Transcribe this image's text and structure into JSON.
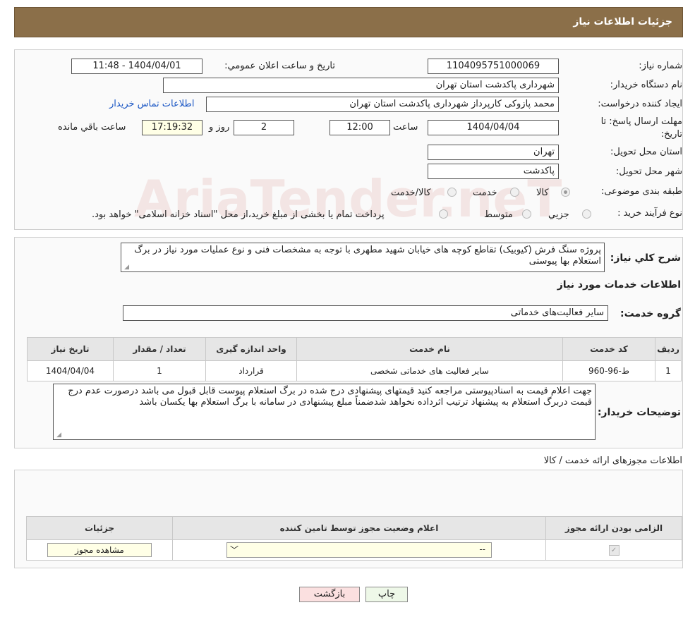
{
  "header": {
    "title": "جزئیات اطلاعات نیاز"
  },
  "form": {
    "need_number_label": "شماره نیاز:",
    "need_number": "1104095751000069",
    "announce_label": "تاریخ و ساعت اعلان عمومي:",
    "announce_value": "1404/04/01 - 11:48",
    "buyer_org_label": "نام دستگاه خريدار:",
    "buyer_org": "شهرداری پاکدشت استان تهران",
    "creator_label": "ايجاد کننده درخواست:",
    "creator": "محمد پازوکی کارپرداز شهرداری پاکدشت استان تهران",
    "contact_link": "اطلاعات تماس خريدار",
    "deadline_label_1": "مهلت ارسال پاسخ: تا",
    "deadline_label_2": "تاريخ:",
    "deadline_date": "1404/04/04",
    "time_label": "ساعت",
    "deadline_time": "12:00",
    "days_value": "2",
    "days_label": "روز و",
    "remaining_time": "17:19:32",
    "remaining_label": "ساعت باقي مانده",
    "province_label": "استان محل تحويل:",
    "province": "تهران",
    "city_label": "شهر محل تحويل:",
    "city": "پاکدشت",
    "category_label": "طبقه بندی موضوعی:",
    "category_options": [
      "کالا",
      "خدمت",
      "کالا/خدمت"
    ],
    "purchase_type_label": "نوع فرآیند خرید :",
    "purchase_options": [
      "جزيي",
      "متوسط"
    ],
    "purchase_note": "پرداخت تمام يا بخشی از مبلغ خريد،از محل \"اسناد خزانه اسلامی\" خواهد بود."
  },
  "details": {
    "summary_label": "شرح کلي نياز:",
    "summary": "پروژه سنگ فرش (کیوبیک) تقاطع کوچه های خیابان شهید مطهری با توجه به مشخصات فنی و نوع عملیات مورد نیاز در برگ استعلام بها پیوستی",
    "services_title": "اطلاعات خدمات مورد نياز",
    "service_group_label": "گروه خدمت:",
    "service_group": "ساير فعاليت‌های خدماتی"
  },
  "services_table": {
    "headers": [
      "رديف",
      "کد خدمت",
      "نام خدمت",
      "واحد اندازه گيری",
      "تعداد / مقدار",
      "تاريخ نياز"
    ],
    "rows": [
      [
        "1",
        "ط-96-960",
        "ساير فعاليت های خدماتی شخصی",
        "قرارداد",
        "1",
        "1404/04/04"
      ]
    ]
  },
  "buyer_notes": {
    "label": "توضيحات خريدار:",
    "text": "جهت اعلام قیمت به اسنادپیوستی مراجعه کنید قیمتهای پیشنهادی درج شده در برگ استعلام پیوست قابل قبول می باشد درصورت عدم درج قیمت دربرگ استعلام به پیشنهاد ترتیب اثرداده نخواهد شدضمناً مبلغ پیشنهادی در سامانه با برگ استعلام بها یکسان باشد"
  },
  "permits": {
    "title": "اطلاعات مجوزهای ارائه خدمت / کالا",
    "headers": [
      "الزامی بودن ارائه مجوز",
      "اعلام وضعيت مجوز توسط تامين کننده",
      "جزئيات"
    ],
    "select_value": "--",
    "view_button": "مشاهده مجوز"
  },
  "buttons": {
    "print": "چاپ",
    "back": "بازگشت"
  },
  "watermark": "AriaTender.neT",
  "colors": {
    "header_bg": "#8b6f49",
    "link": "#1a56c4",
    "back_button_bg": "#fbe0e0",
    "print_button_bg": "#eef8e8"
  }
}
